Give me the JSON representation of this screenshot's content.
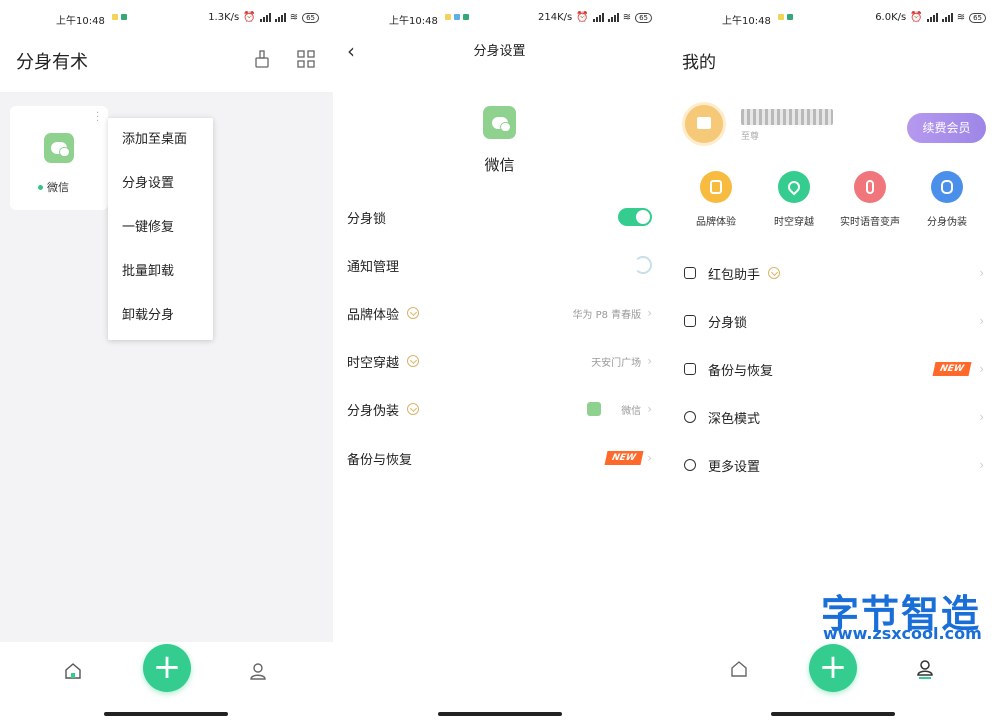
{
  "colors": {
    "accent": "#35cc8f",
    "vip": "#9d86e6",
    "new_badge": "#ff6a2a"
  },
  "panel1": {
    "status": {
      "time": "上午10:48",
      "speed": "1.3K/s",
      "battery": "65"
    },
    "title": "分身有术",
    "header_icons": [
      "broom-icon",
      "grid-icon"
    ],
    "app": {
      "name": "微信",
      "icon": "wechat-icon"
    },
    "menu": [
      "添加至桌面",
      "分身设置",
      "一键修复",
      "批量卸载",
      "卸载分身"
    ]
  },
  "panel2": {
    "status": {
      "time": "上午10:48",
      "speed": "214K/s",
      "battery": "65"
    },
    "title": "分身设置",
    "app_name": "微信",
    "rows": [
      {
        "label": "分身锁",
        "control": "toggle-on"
      },
      {
        "label": "通知管理",
        "control": "toggle-loading"
      },
      {
        "label": "品牌体验",
        "value": "华为 P8 青春版",
        "premium": true
      },
      {
        "label": "时空穿越",
        "value": "天安门广场",
        "premium": true
      },
      {
        "label": "分身伪装",
        "value": "微信",
        "premium": true
      },
      {
        "label": "备份与恢复",
        "badge": "NEW"
      }
    ]
  },
  "panel3": {
    "status": {
      "time": "上午10:48",
      "speed": "6.0K/s",
      "battery": "65"
    },
    "title": "我的",
    "user_tier": "至尊",
    "renew_label": "续费会员",
    "features": [
      {
        "label": "品牌体验",
        "color": "#f7bb40"
      },
      {
        "label": "时空穿越",
        "color": "#35cc8f"
      },
      {
        "label": "实时语音变声",
        "color": "#f1767c"
      },
      {
        "label": "分身伪装",
        "color": "#4a8fea"
      }
    ],
    "menu": [
      {
        "label": "红包助手",
        "premium": true
      },
      {
        "label": "分身锁"
      },
      {
        "label": "备份与恢复",
        "badge": "NEW"
      },
      {
        "label": "深色模式"
      },
      {
        "label": "更多设置"
      }
    ],
    "watermark": "字节智造",
    "watermark_url": "www.zsxcool.com"
  }
}
